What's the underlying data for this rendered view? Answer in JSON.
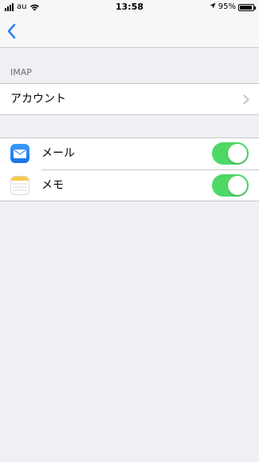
{
  "status_bar": {
    "carrier": "au",
    "time": "13:58",
    "battery_percent_label": "95%",
    "battery_level": 0.95,
    "signal_bars": 4,
    "icons": [
      "signal-icon",
      "wifi-icon",
      "location-arrow-icon",
      "battery-icon"
    ]
  },
  "nav": {
    "back_icon": "chevron-left-icon",
    "title": "",
    "accent_color": "#2f7cf6"
  },
  "imap_section": {
    "header": "IMAP",
    "account_label": "アカウント",
    "account_value": "",
    "chevron_icon": "chevron-right-icon"
  },
  "apps": [
    {
      "label": "メール",
      "icon": "mail-icon",
      "enabled": true
    },
    {
      "label": "メモ",
      "icon": "notes-icon",
      "enabled": true
    }
  ],
  "footer": {
    "text": ""
  },
  "colors": {
    "toggle_on": "#4cd964",
    "background": "#efeff4"
  }
}
